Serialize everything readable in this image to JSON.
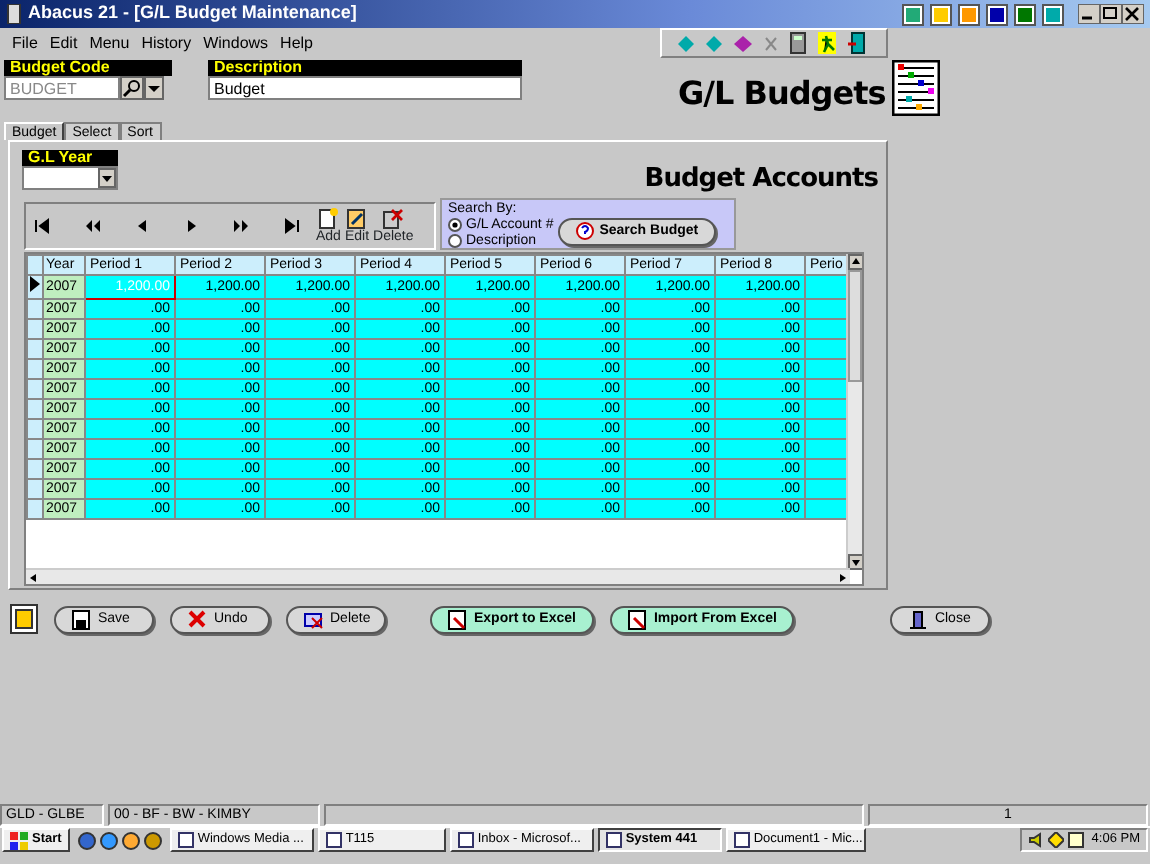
{
  "window": {
    "title": "Abacus 21 - [G/L Budget Maintenance]"
  },
  "menu": [
    "File",
    "Edit",
    "Menu",
    "History",
    "Windows",
    "Help"
  ],
  "header": {
    "budget_code": {
      "label": "Budget Code",
      "value": "BUDGET"
    },
    "description": {
      "label": "Description",
      "value": "Budget"
    },
    "title": "G/L Budgets"
  },
  "tabs": [
    {
      "label": "Budget",
      "selected": true
    },
    {
      "label": "Select",
      "selected": false
    },
    {
      "label": "Sort",
      "selected": false
    }
  ],
  "gl_year": {
    "label": "G.L Year"
  },
  "section_title": "Budget Accounts",
  "record_buttons": [
    "Add",
    "Edit",
    "Delete"
  ],
  "search": {
    "label": "Search By:",
    "options": [
      {
        "label": "G/L Account #",
        "selected": true
      },
      {
        "label": "Description",
        "selected": false
      }
    ],
    "button": "Search Budget"
  },
  "table": {
    "columns": [
      "Year",
      "Period 1",
      "Period 2",
      "Period 3",
      "Period 4",
      "Period 5",
      "Period 6",
      "Period 7",
      "Period 8",
      "Perio"
    ],
    "rows": [
      {
        "selected": true,
        "cells": [
          "2007",
          "1,200.00",
          "1,200.00",
          "1,200.00",
          "1,200.00",
          "1,200.00",
          "1,200.00",
          "1,200.00",
          "1,200.00"
        ]
      },
      {
        "selected": false,
        "cells": [
          "2007",
          ".00",
          ".00",
          ".00",
          ".00",
          ".00",
          ".00",
          ".00",
          ".00"
        ]
      },
      {
        "selected": false,
        "cells": [
          "2007",
          ".00",
          ".00",
          ".00",
          ".00",
          ".00",
          ".00",
          ".00",
          ".00"
        ]
      },
      {
        "selected": false,
        "cells": [
          "2007",
          ".00",
          ".00",
          ".00",
          ".00",
          ".00",
          ".00",
          ".00",
          ".00"
        ]
      },
      {
        "selected": false,
        "cells": [
          "2007",
          ".00",
          ".00",
          ".00",
          ".00",
          ".00",
          ".00",
          ".00",
          ".00"
        ]
      },
      {
        "selected": false,
        "cells": [
          "2007",
          ".00",
          ".00",
          ".00",
          ".00",
          ".00",
          ".00",
          ".00",
          ".00"
        ]
      },
      {
        "selected": false,
        "cells": [
          "2007",
          ".00",
          ".00",
          ".00",
          ".00",
          ".00",
          ".00",
          ".00",
          ".00"
        ]
      },
      {
        "selected": false,
        "cells": [
          "2007",
          ".00",
          ".00",
          ".00",
          ".00",
          ".00",
          ".00",
          ".00",
          ".00"
        ]
      },
      {
        "selected": false,
        "cells": [
          "2007",
          ".00",
          ".00",
          ".00",
          ".00",
          ".00",
          ".00",
          ".00",
          ".00"
        ]
      },
      {
        "selected": false,
        "cells": [
          "2007",
          ".00",
          ".00",
          ".00",
          ".00",
          ".00",
          ".00",
          ".00",
          ".00"
        ]
      },
      {
        "selected": false,
        "cells": [
          "2007",
          ".00",
          ".00",
          ".00",
          ".00",
          ".00",
          ".00",
          ".00",
          ".00"
        ]
      },
      {
        "selected": false,
        "cells": [
          "2007",
          ".00",
          ".00",
          ".00",
          ".00",
          ".00",
          ".00",
          ".00",
          ".00"
        ]
      }
    ]
  },
  "actions": [
    {
      "label": "Save",
      "kind": "plain"
    },
    {
      "label": "Undo",
      "kind": "plain"
    },
    {
      "label": "Delete",
      "kind": "plain"
    },
    {
      "label": "Export to Excel",
      "kind": "excel"
    },
    {
      "label": "Import From Excel",
      "kind": "excel"
    },
    {
      "label": "Close",
      "kind": "plain"
    }
  ],
  "status_bar": [
    "GLD - GLBE",
    "00 - BF - BW - KIMBY",
    "1"
  ],
  "taskbar": {
    "start": "Start",
    "tasks": [
      {
        "label": "Windows Media ...",
        "selected": false
      },
      {
        "label": "T115",
        "selected": false
      },
      {
        "label": "Inbox - Microsof...",
        "selected": false
      },
      {
        "label": "System 441",
        "selected": true
      },
      {
        "label": "Document1 - Mic...",
        "selected": false
      }
    ],
    "clock": "4:06 PM"
  }
}
